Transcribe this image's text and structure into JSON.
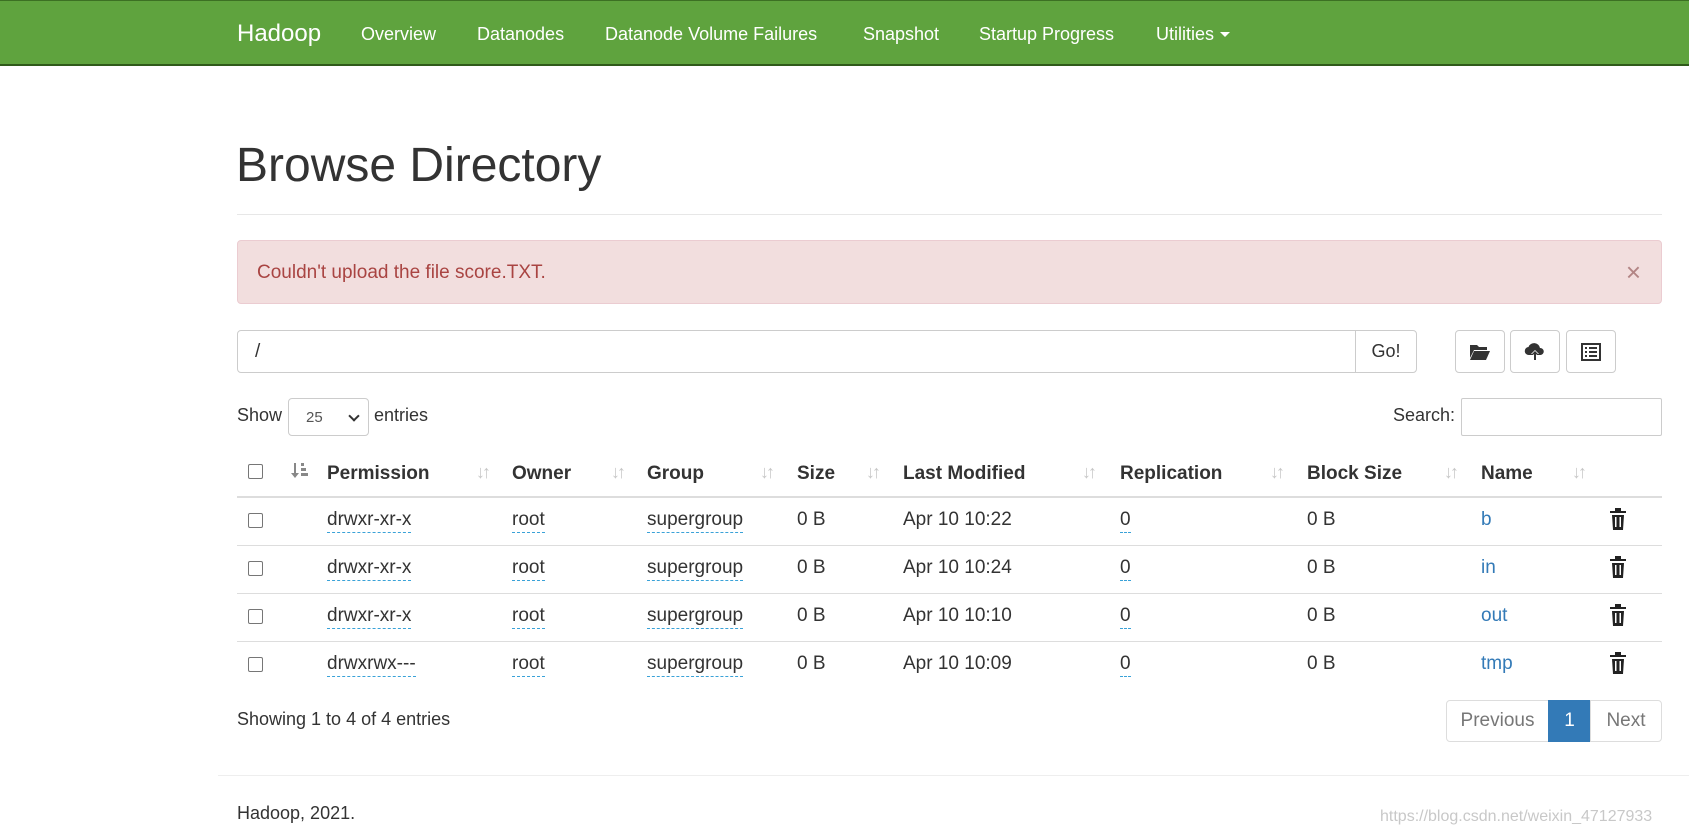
{
  "navbar": {
    "brand": "Hadoop",
    "items": [
      "Overview",
      "Datanodes",
      "Datanode Volume Failures",
      "Snapshot",
      "Startup Progress",
      "Utilities"
    ],
    "color": "#5fa33e"
  },
  "page_title": "Browse Directory",
  "alert": {
    "message": "Couldn't upload the file score.TXT.",
    "close": "×"
  },
  "path_bar": {
    "value": "/",
    "go_label": "Go!",
    "icons": [
      "folder-open-icon",
      "cloud-upload-icon",
      "list-alt-icon"
    ]
  },
  "table_controls": {
    "show_label": "Show",
    "page_length": "25",
    "entries_label": "entries",
    "search_label": "Search:"
  },
  "table": {
    "columns": [
      "Permission",
      "Owner",
      "Group",
      "Size",
      "Last Modified",
      "Replication",
      "Block Size",
      "Name"
    ],
    "rows": [
      {
        "permission": "drwxr-xr-x",
        "owner": "root",
        "group": "supergroup",
        "size": "0 B",
        "modified": "Apr 10 10:22",
        "replication": "0",
        "block_size": "0 B",
        "name": "b"
      },
      {
        "permission": "drwxr-xr-x",
        "owner": "root",
        "group": "supergroup",
        "size": "0 B",
        "modified": "Apr 10 10:24",
        "replication": "0",
        "block_size": "0 B",
        "name": "in"
      },
      {
        "permission": "drwxr-xr-x",
        "owner": "root",
        "group": "supergroup",
        "size": "0 B",
        "modified": "Apr 10 10:10",
        "replication": "0",
        "block_size": "0 B",
        "name": "out"
      },
      {
        "permission": "drwxrwx---",
        "owner": "root",
        "group": "supergroup",
        "size": "0 B",
        "modified": "Apr 10 10:09",
        "replication": "0",
        "block_size": "0 B",
        "name": "tmp"
      }
    ]
  },
  "info": "Showing 1 to 4 of 4 entries",
  "pagination": {
    "previous": "Previous",
    "current": "1",
    "next": "Next",
    "active_color": "#337ab7"
  },
  "footer": "Hadoop, 2021.",
  "watermark": "https://blog.csdn.net/weixin_47127933"
}
